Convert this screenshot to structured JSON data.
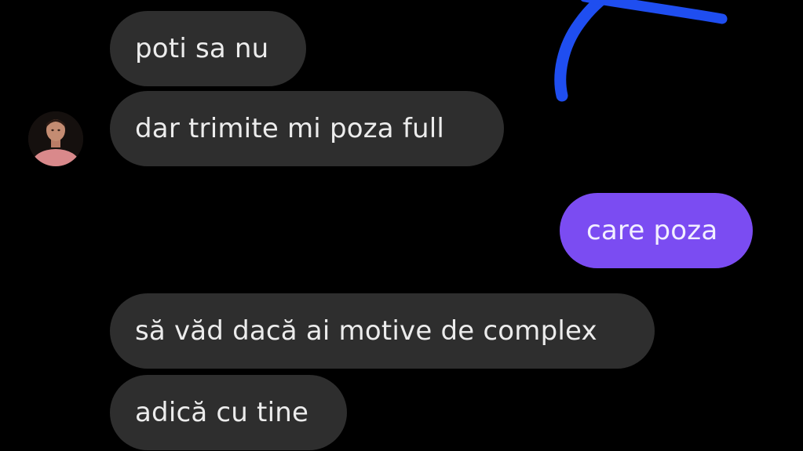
{
  "conversation": {
    "messages": [
      {
        "sender": "contact",
        "text": "poti sa nu"
      },
      {
        "sender": "contact",
        "text": "dar trimite mi poza full"
      },
      {
        "sender": "me",
        "text": "care poza"
      },
      {
        "sender": "contact",
        "text": "să văd dacă ai motive de complex"
      },
      {
        "sender": "contact",
        "text": "adică cu tine"
      }
    ]
  },
  "colors": {
    "background": "#000000",
    "incoming_bubble": "#2e2e2e",
    "outgoing_bubble": "#7b4cf2",
    "annotation_stroke": "#1f4ef0"
  },
  "icons": {
    "contact_avatar": "avatar-photo",
    "annotation": "blue-pen-scribble"
  }
}
